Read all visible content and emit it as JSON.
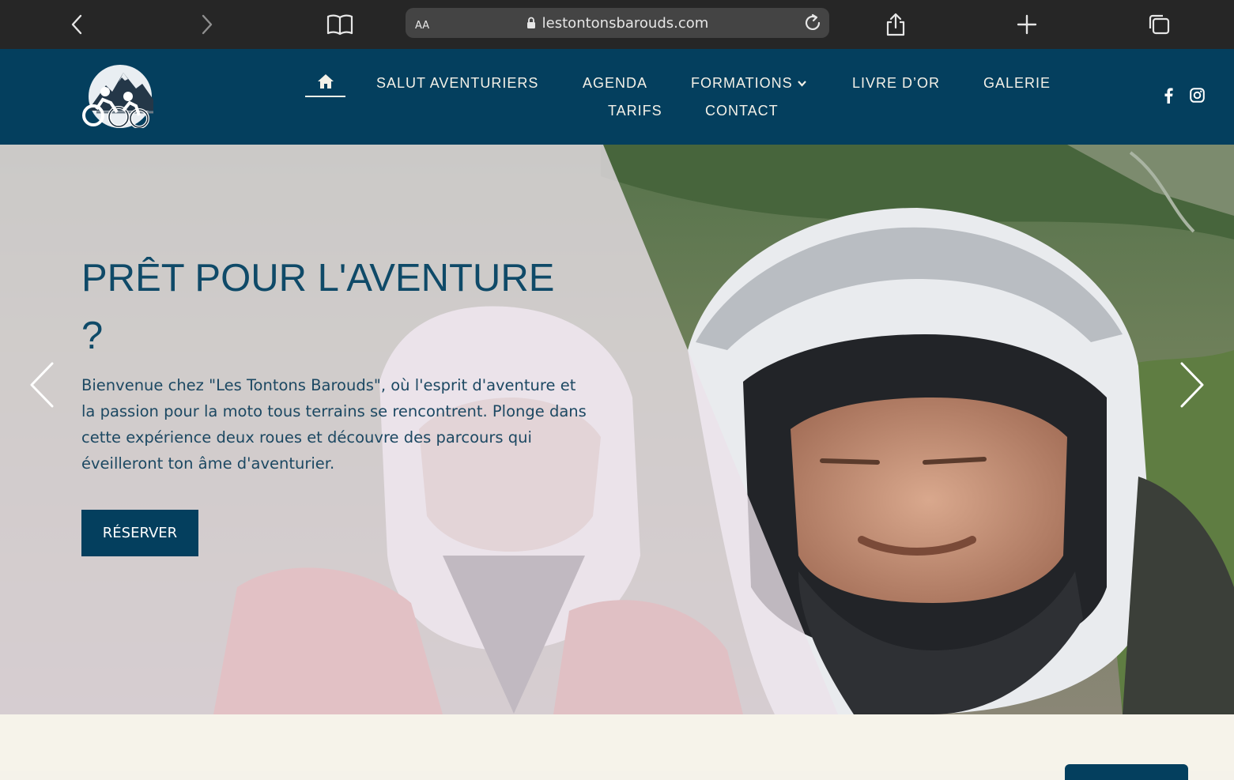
{
  "browser": {
    "aa_label": "AA",
    "url": "lestontonsbarouds.com",
    "icons": [
      "back-icon",
      "forward-icon",
      "bookmarks-icon",
      "lock-icon",
      "reload-icon",
      "share-icon",
      "plus-icon",
      "tabs-icon"
    ]
  },
  "header": {
    "logo_name": "mountain-bikers-logo",
    "nav": {
      "home_icon": "home-icon",
      "salut": "SALUT AVENTURIERS",
      "agenda": "AGENDA",
      "formations": "FORMATIONS",
      "livre": "LIVRE D’OR",
      "galerie": "GALERIE",
      "tarifs": "TARIFS",
      "contact": "CONTACT"
    },
    "social": [
      "facebook-icon",
      "instagram-icon"
    ]
  },
  "hero": {
    "title_line1": "PRÊT POUR L'AVENTURE",
    "title_line2": "?",
    "text": "Bienvenue chez \"Les Tontons Barouds\", où l'esprit d'aventure et la passion pour la moto tous terrains se rencontrent. Plonge dans cette expérience deux roues et découvre des parcours qui éveilleront ton âme d'aventurier.",
    "button": "RÉSERVER"
  },
  "colors": {
    "brand_dark": "#043f5e",
    "cream": "#f5f2ea",
    "chrome": "#262626"
  }
}
